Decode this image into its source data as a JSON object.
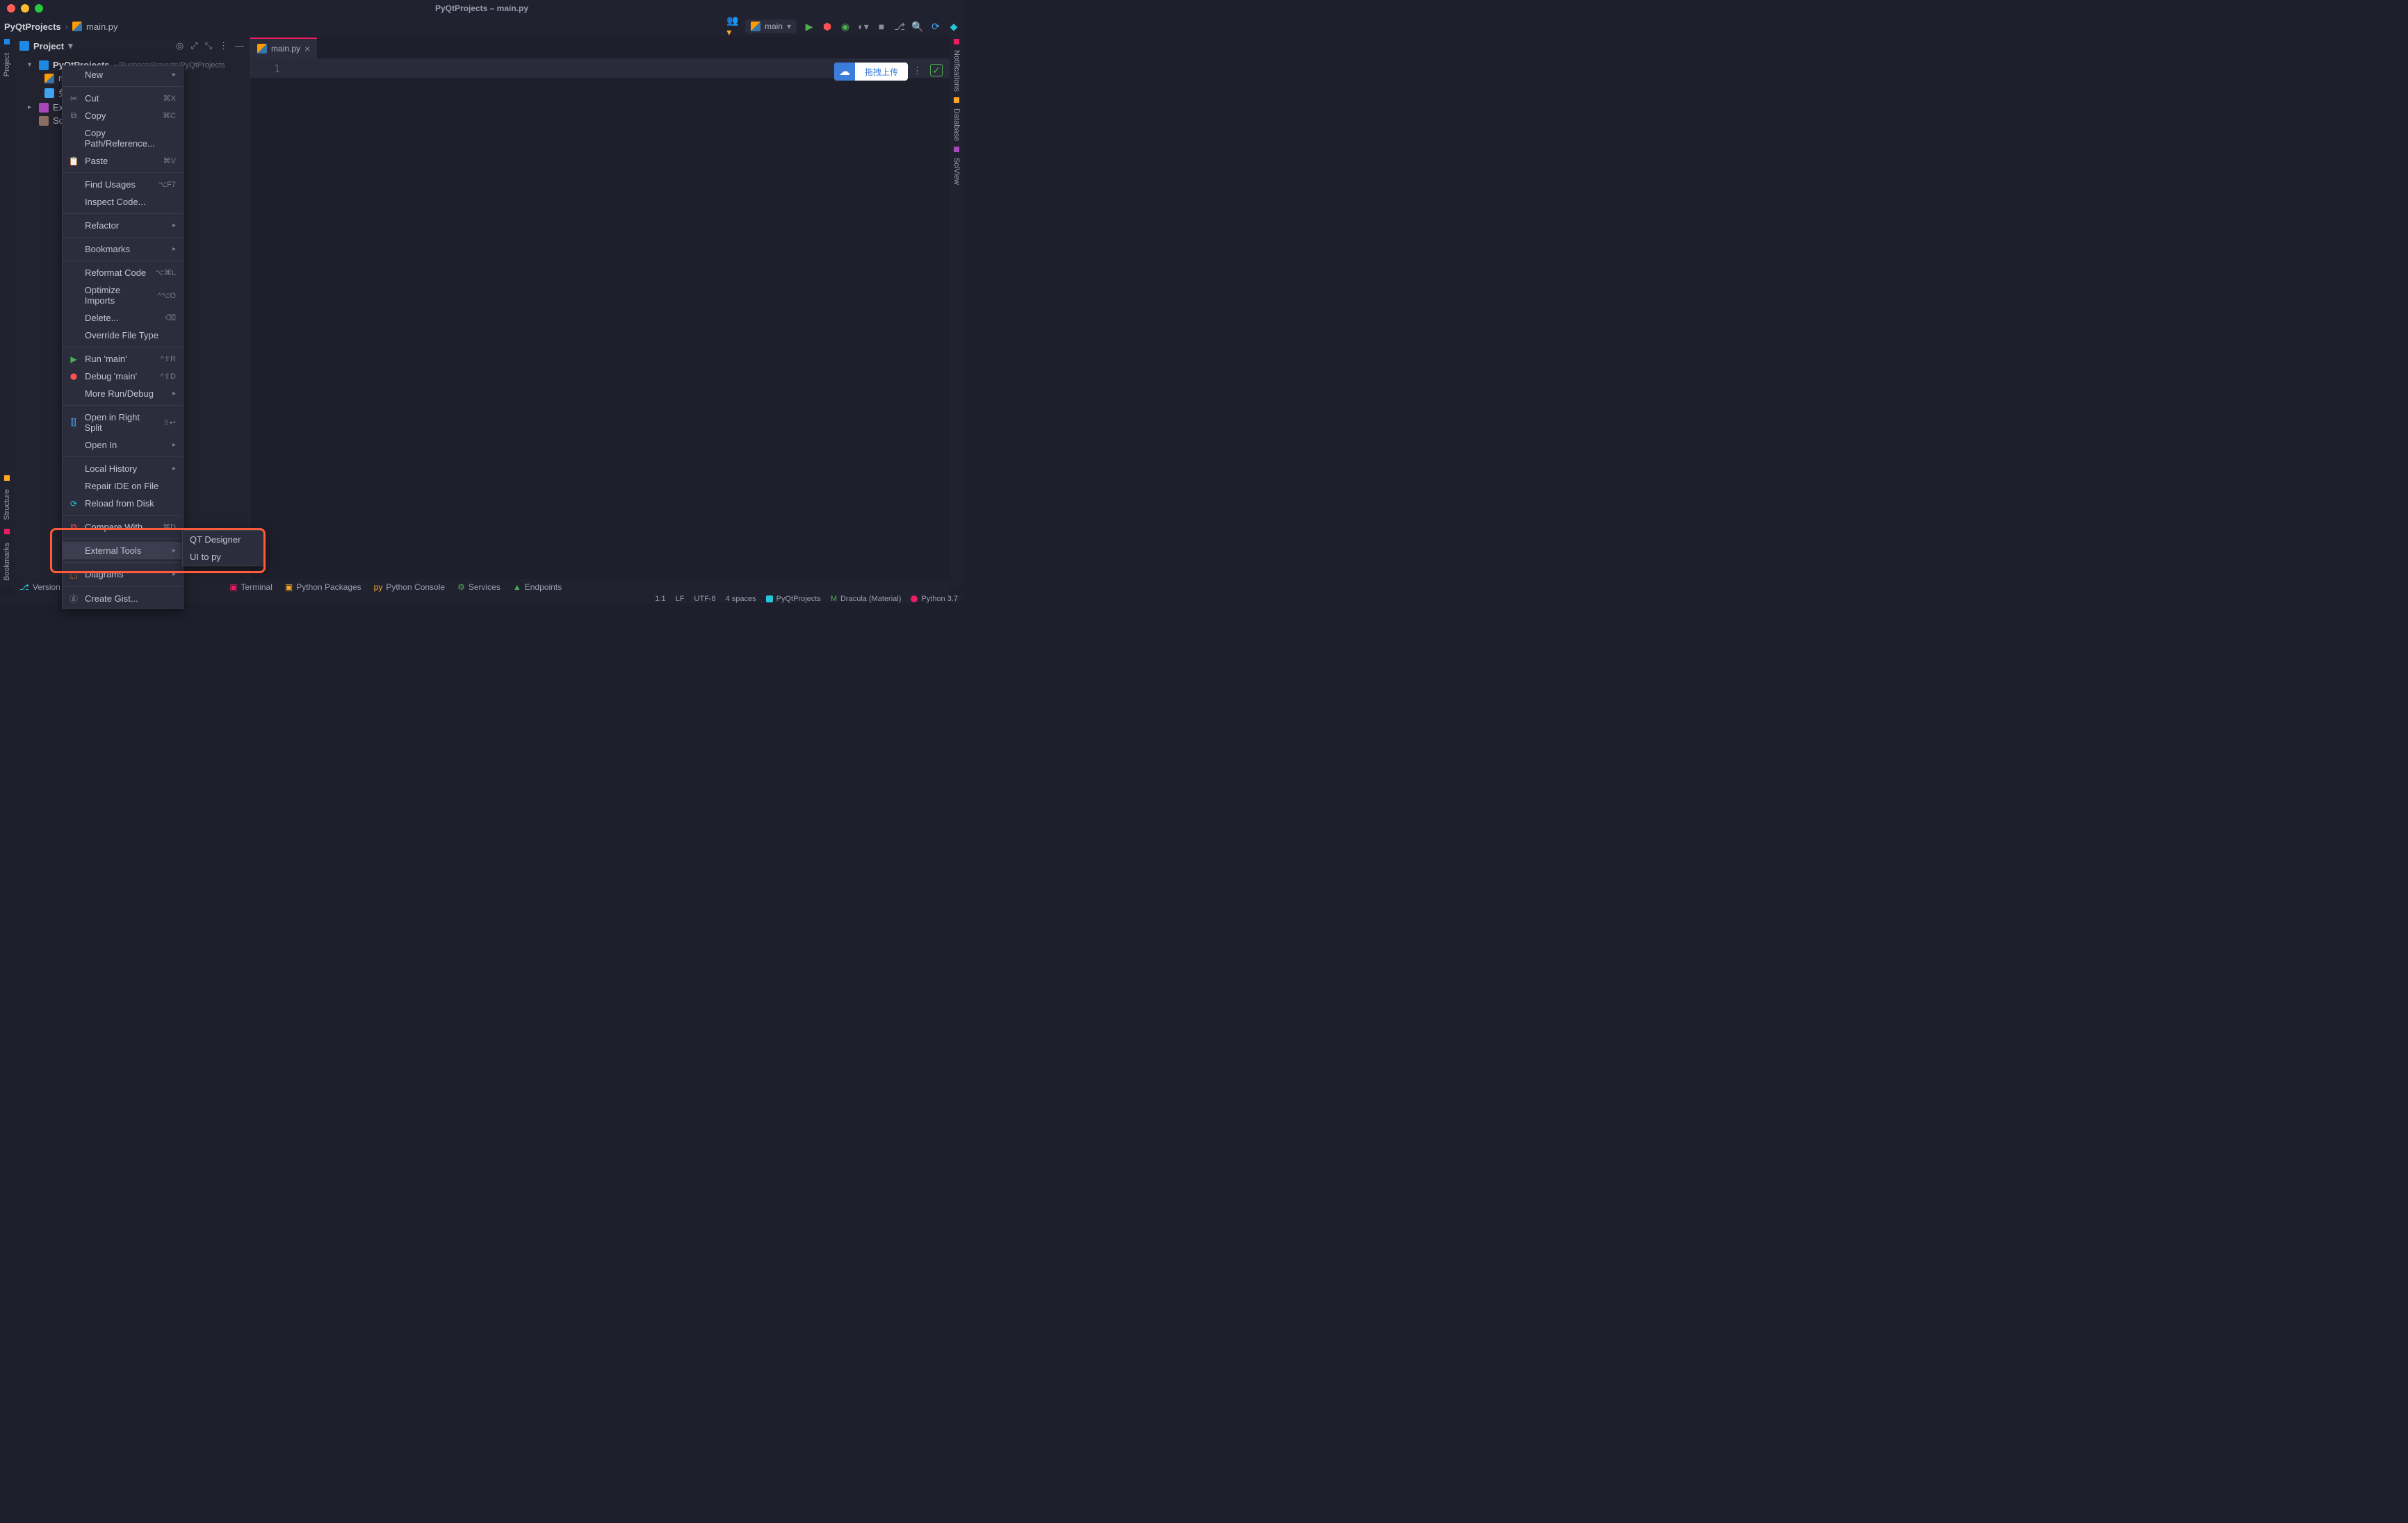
{
  "window": {
    "title": "PyQtProjects – main.py"
  },
  "breadcrumb": {
    "project": "PyQtProjects",
    "file": "main.py"
  },
  "run_config": {
    "name": "main"
  },
  "left_tabs": {
    "project": "Project",
    "structure": "Structure",
    "bookmarks": "Bookmarks"
  },
  "right_tabs": {
    "notifications": "Notifications",
    "database": "Database",
    "sciview": "SciView"
  },
  "project_panel": {
    "title": "Project",
    "root": "PyQtProjects",
    "root_path": "~/PycharmProjects/PyQtProjects",
    "files": {
      "main": "main.",
      "img": "兔年头"
    },
    "external": "External",
    "scratches": "Scratche"
  },
  "tab": {
    "file": "main.py"
  },
  "editor": {
    "line1": "1"
  },
  "widget": {
    "label": "拖拽上传"
  },
  "context_menu": {
    "new": "New",
    "cut": "Cut",
    "cut_sc": "⌘X",
    "copy": "Copy",
    "copy_sc": "⌘C",
    "copy_path": "Copy Path/Reference...",
    "paste": "Paste",
    "paste_sc": "⌘V",
    "find_usages": "Find Usages",
    "find_usages_sc": "⌥F7",
    "inspect": "Inspect Code...",
    "refactor": "Refactor",
    "bookmarks": "Bookmarks",
    "reformat": "Reformat Code",
    "reformat_sc": "⌥⌘L",
    "optimize": "Optimize Imports",
    "optimize_sc": "^⌥O",
    "delete": "Delete...",
    "delete_sc": "⌫",
    "override": "Override File Type",
    "run": "Run 'main'",
    "run_sc": "^⇧R",
    "debug": "Debug 'main'",
    "debug_sc": "^⇧D",
    "more_run": "More Run/Debug",
    "open_split": "Open in Right Split",
    "open_split_sc": "⇧↩",
    "open_in": "Open In",
    "local_history": "Local History",
    "repair": "Repair IDE on File",
    "reload": "Reload from Disk",
    "compare": "Compare With...",
    "compare_sc": "⌘D",
    "external_tools": "External Tools",
    "diagrams": "Diagrams",
    "create_gist": "Create Gist..."
  },
  "submenu": {
    "qt_designer": "QT Designer",
    "ui_to_py": "UI  to py"
  },
  "bottom_tools": {
    "version": "Version Con",
    "terminal": "Terminal",
    "py_packages": "Python Packages",
    "py_console": "Python Console",
    "services": "Services",
    "endpoints": "Endpoints"
  },
  "status": {
    "pos": "1:1",
    "le": "LF",
    "enc": "UTF-8",
    "indent": "4 spaces",
    "project": "PyQtProjects",
    "theme": "Dracula (Material)",
    "interp": "Python 3.7"
  }
}
